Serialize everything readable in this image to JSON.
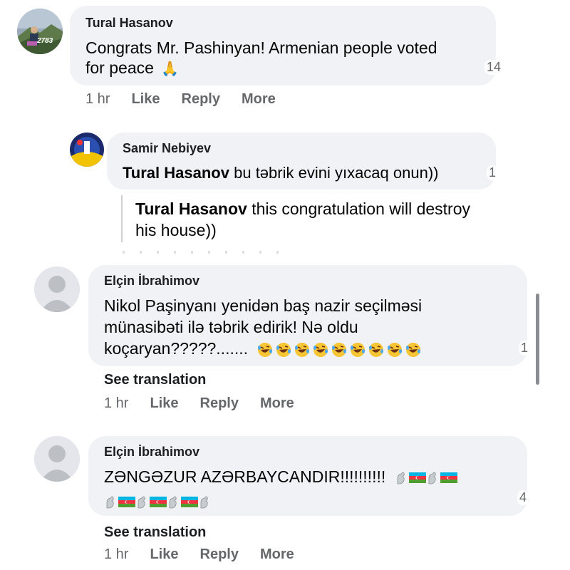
{
  "comments": [
    {
      "author": "Tural Hasanov",
      "text_line1": "Congrats Mr. Pashinyan! Armenian people voted",
      "text_line2": "for peace",
      "emoji": "🙏",
      "reactions": "14",
      "time": "1 hr",
      "like": "Like",
      "reply": "Reply",
      "more": "More",
      "avatar_overlay": "2783"
    },
    {
      "author": "Samir Nebiyev",
      "mention": "Tural Hasanov",
      "text": "bu təbrik evini yıxacaq onun))",
      "reactions": "1",
      "translation_mention": "Tural Hasanov",
      "translation_line1": "this congratulation will destroy",
      "translation_line2": "his house))"
    },
    {
      "author": "Elçin İbrahimov",
      "text_line1": "Nikol Paşinyanı yenidən baş nazir seçilməsi",
      "text_line2": "münasibəti ilə təbrik edirik! Nə oldu",
      "text_line3": "koçaryan?????.......",
      "reactions": "1",
      "see_translation": "See translation",
      "time": "1 hr",
      "like": "Like",
      "reply": "Reply",
      "more": "More"
    },
    {
      "author": "Elçin İbrahimov",
      "text_line1": "ZƏNGƏZUR AZƏRBAYCANDIR!!!!!!!!!!",
      "reactions": "4",
      "see_translation": "See translation",
      "time": "1 hr",
      "like": "Like",
      "reply": "Reply",
      "more": "More"
    }
  ],
  "icons": {
    "pray": "folded-hands-emoji",
    "laugh": "rolling-on-floor-laughing-emoji",
    "arm": "flexed-arm-emoji",
    "flag": "azerbaijan-flag-emoji"
  },
  "colors": {
    "bubble": "#f0f2f5",
    "meta": "#65676b",
    "flag_blue": "#00b5e2",
    "flag_red": "#ef3340",
    "flag_green": "#509e2f"
  }
}
